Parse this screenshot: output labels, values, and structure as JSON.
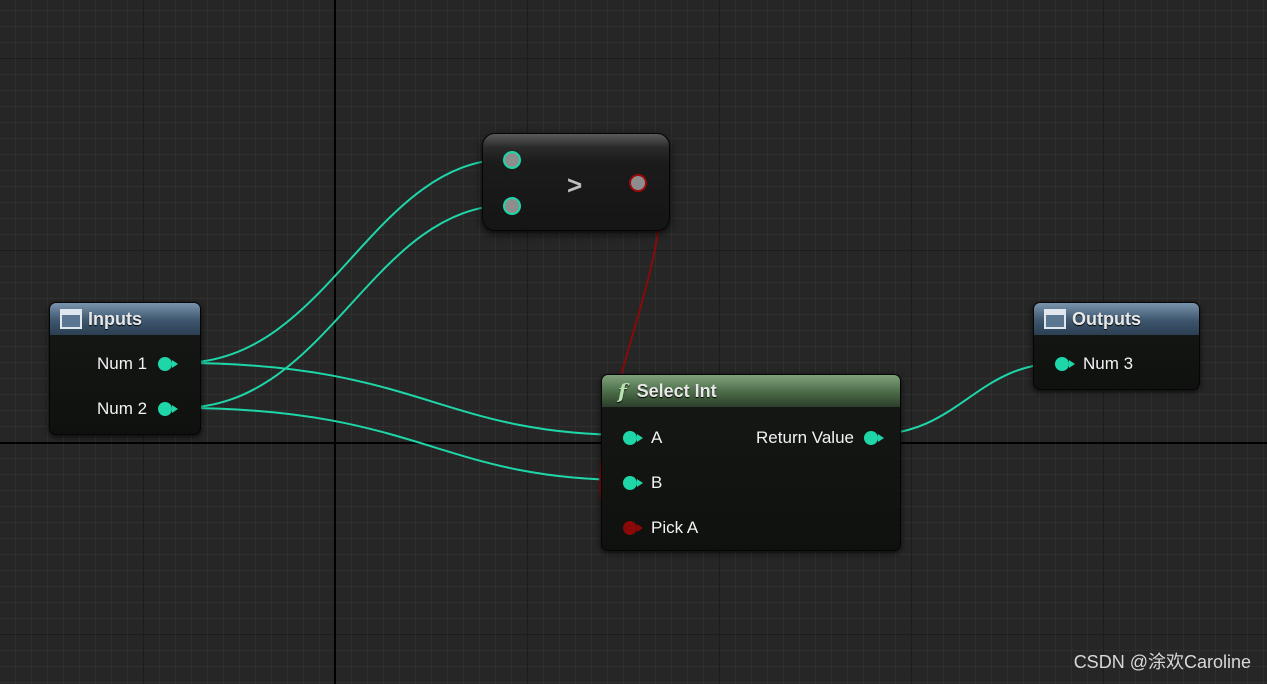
{
  "compare_node": {
    "operator": ">"
  },
  "inputs_node": {
    "title": "Inputs",
    "pins": [
      {
        "label": "Num 1"
      },
      {
        "label": "Num 2"
      }
    ]
  },
  "select_node": {
    "title": "Select Int",
    "func_icon": "f",
    "pins": {
      "a": "A",
      "b": "B",
      "pick": "Pick A",
      "return": "Return Value"
    }
  },
  "outputs_node": {
    "title": "Outputs",
    "pins": [
      {
        "label": "Num 3"
      }
    ]
  },
  "colors": {
    "background": "#262626",
    "integer_pin": "#1ed6a8",
    "bool_pin": "#8a0808",
    "io_header": "#3d566e",
    "function_header": "#4a6a47"
  },
  "watermark": "CSDN @涂欢Caroline"
}
